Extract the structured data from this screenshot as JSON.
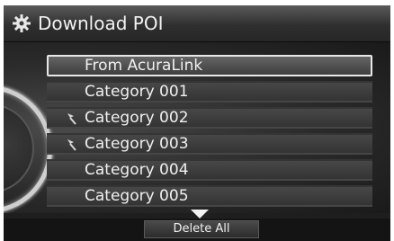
{
  "header": {
    "title": "Download POI",
    "icon": "settings-gear-icon"
  },
  "list": {
    "items": [
      {
        "label": "From AcuraLink",
        "selected": true,
        "icon": null
      },
      {
        "label": "Category 001",
        "selected": false,
        "icon": null
      },
      {
        "label": "Category 002",
        "selected": false,
        "icon": "pin-flag-icon"
      },
      {
        "label": "Category 003",
        "selected": false,
        "icon": "pin-flag-icon"
      },
      {
        "label": "Category 004",
        "selected": false,
        "icon": null
      },
      {
        "label": "Category 005",
        "selected": false,
        "icon": null
      }
    ],
    "scroll_indicator": "down-arrow-icon"
  },
  "footer": {
    "delete_all_label": "Delete All"
  },
  "colors": {
    "background": "#1e1e1e",
    "text": "#f0f0f0",
    "selected_border": "#e8e8e8"
  }
}
